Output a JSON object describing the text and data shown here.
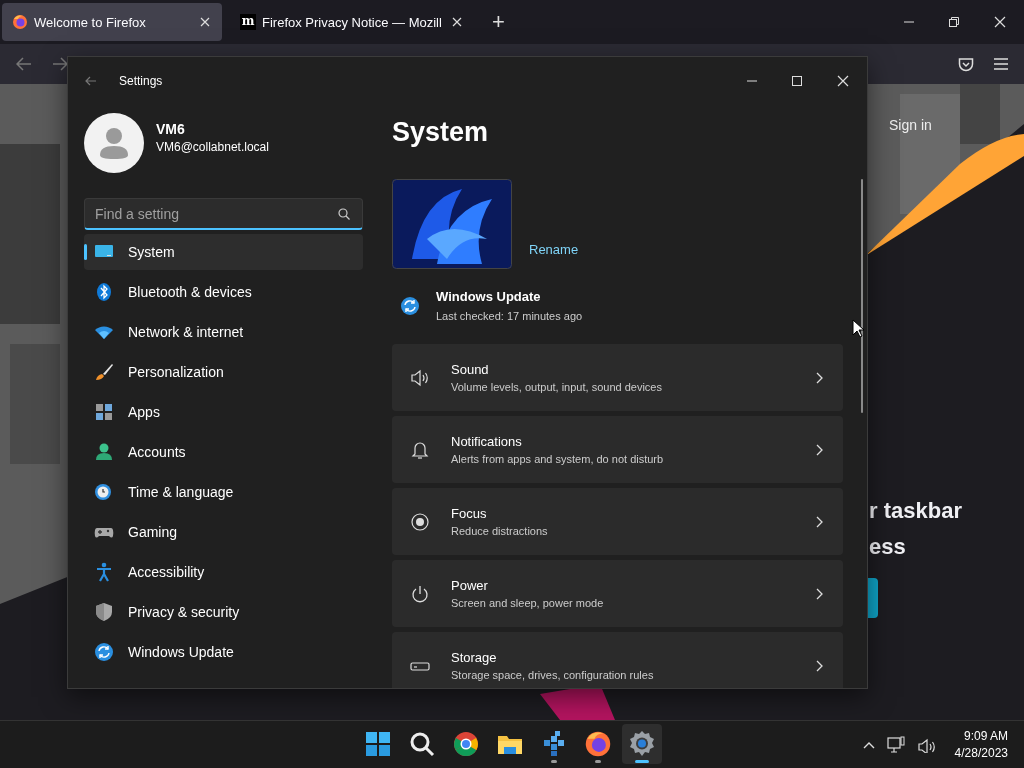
{
  "browser": {
    "tabs": [
      {
        "title": "Welcome to Firefox",
        "selected": true
      },
      {
        "title": "Firefox Privacy Notice — Mozill",
        "favicon_text": "m",
        "selected": false
      }
    ],
    "new_tab": "+"
  },
  "page": {
    "sign_in": "Sign in",
    "heading_lines": [
      "r taskbar",
      "ess"
    ]
  },
  "settings": {
    "title": "Settings",
    "user": {
      "name": "VM6",
      "email": "VM6@collabnet.local"
    },
    "search": {
      "placeholder": "Find a setting"
    },
    "nav": [
      {
        "label": "System",
        "selected": true
      },
      {
        "label": "Bluetooth & devices",
        "selected": false
      },
      {
        "label": "Network & internet",
        "selected": false
      },
      {
        "label": "Personalization",
        "selected": false
      },
      {
        "label": "Apps",
        "selected": false
      },
      {
        "label": "Accounts",
        "selected": false
      },
      {
        "label": "Time & language",
        "selected": false
      },
      {
        "label": "Gaming",
        "selected": false
      },
      {
        "label": "Accessibility",
        "selected": false
      },
      {
        "label": "Privacy & security",
        "selected": false
      },
      {
        "label": "Windows Update",
        "selected": false
      }
    ],
    "page_title": "System",
    "device": {
      "action": "Rename"
    },
    "update": {
      "title": "Windows Update",
      "status": "Last checked: 17 minutes ago"
    },
    "cards": [
      {
        "title": "Sound",
        "subtitle": "Volume levels, output, input, sound devices"
      },
      {
        "title": "Notifications",
        "subtitle": "Alerts from apps and system, do not disturb"
      },
      {
        "title": "Focus",
        "subtitle": "Reduce distractions"
      },
      {
        "title": "Power",
        "subtitle": "Screen and sleep, power mode"
      },
      {
        "title": "Storage",
        "subtitle": "Storage space, drives, configuration rules"
      }
    ]
  },
  "taskbar": {
    "apps": [
      {
        "running": false,
        "selected": false
      },
      {
        "running": false,
        "selected": false
      },
      {
        "running": false,
        "selected": false
      },
      {
        "running": false,
        "selected": false
      },
      {
        "running": true,
        "selected": false
      },
      {
        "running": true,
        "selected": false
      },
      {
        "running": true,
        "selected": true
      }
    ],
    "clock": {
      "time": "9:09 AM",
      "date": "4/28/2023"
    }
  }
}
